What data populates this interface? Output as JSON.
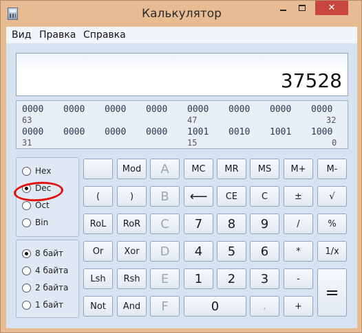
{
  "window": {
    "title": "Калькулятор",
    "close_label": "✕"
  },
  "menu": [
    "Вид",
    "Правка",
    "Справка"
  ],
  "display": {
    "value": "37528"
  },
  "bits": {
    "row1": [
      "0000",
      "0000",
      "0000",
      "0000",
      "0000",
      "0000",
      "0000",
      "0000"
    ],
    "row1_positions": [
      "63",
      "47",
      "32"
    ],
    "row2": [
      "0000",
      "0000",
      "0000",
      "0000",
      "1001",
      "0010",
      "1001",
      "1000"
    ],
    "row2_positions": [
      "31",
      "15",
      "0"
    ]
  },
  "base": {
    "options": [
      "Hex",
      "Dec",
      "Oct",
      "Bin"
    ],
    "selected": "Dec"
  },
  "word": {
    "options": [
      "8 байт",
      "4 байта",
      "2 байта",
      "1 байт"
    ],
    "selected": "8 байт"
  },
  "keys": {
    "blank": "",
    "mod": "Mod",
    "A": "A",
    "mc": "MC",
    "mr": "MR",
    "ms": "MS",
    "mplus": "M+",
    "mminus": "M-",
    "lparen": "(",
    "rparen": ")",
    "B": "B",
    "back": "⟵",
    "ce": "CE",
    "c": "C",
    "pm": "±",
    "sqrt": "√",
    "rol": "RoL",
    "ror": "RoR",
    "C": "C",
    "k7": "7",
    "k8": "8",
    "k9": "9",
    "div": "/",
    "pct": "%",
    "or": "Or",
    "xor": "Xor",
    "D": "D",
    "k4": "4",
    "k5": "5",
    "k6": "6",
    "mul": "*",
    "inv": "1/x",
    "lsh": "Lsh",
    "rsh": "Rsh",
    "E": "E",
    "k1": "1",
    "k2": "2",
    "k3": "3",
    "sub": "-",
    "eq": "=",
    "not": "Not",
    "and": "And",
    "F": "F",
    "k0": "0",
    "dot": ",",
    "add": "+"
  }
}
